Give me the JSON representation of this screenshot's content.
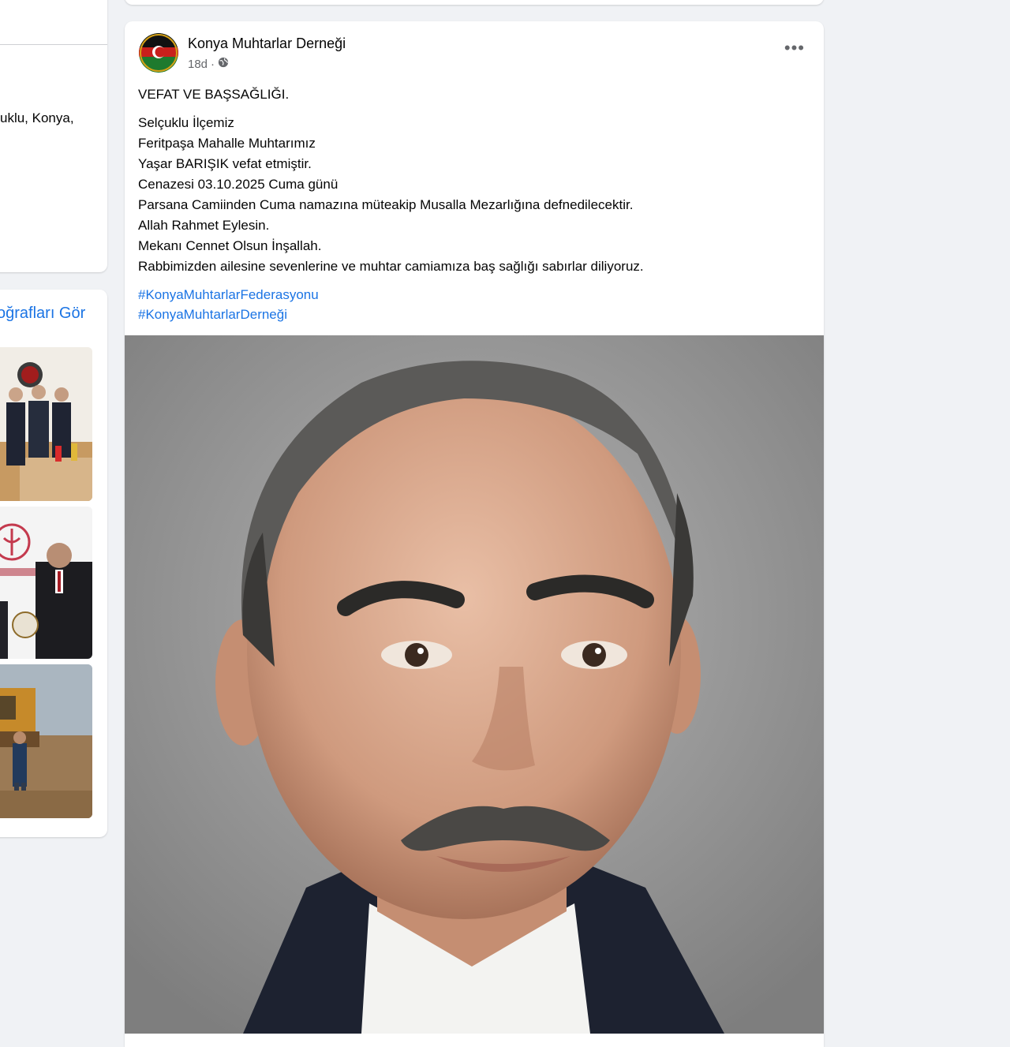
{
  "left_column": {
    "intro_address": "uklu, Konya,",
    "photos_link": "oğrafları Gör"
  },
  "post": {
    "page_name": "Konya Muhtarlar Derneği",
    "time": "18d",
    "privacy_icon": "globe-icon",
    "more_icon": "more-options-icon",
    "title": "VEFAT VE BAŞSAĞLIĞI.",
    "lines": [
      "Selçuklu İlçemiz",
      "Feritpaşa Mahalle Muhtarımız",
      "Yaşar BARIŞIK vefat etmiştir.",
      "Cenazesi 03.10.2025 Cuma günü",
      "Parsana Camiinden Cuma namazına müteakip Musalla Mezarlığına defnedilecektir.",
      "Allah Rahmet Eylesin.",
      "Mekanı Cennet Olsun İnşallah.",
      "Rabbimizden ailesine sevenlerine ve muhtar camiamıza baş sağlığı sabırlar diliyoruz."
    ],
    "hashtags": [
      "#KonyaMuhtarlarFederasyonu",
      "#KonyaMuhtarlarDerneği"
    ]
  },
  "colors": {
    "background": "#f0f2f5",
    "card": "#ffffff",
    "link": "#1b74e4",
    "secondary_text": "#65676b"
  }
}
